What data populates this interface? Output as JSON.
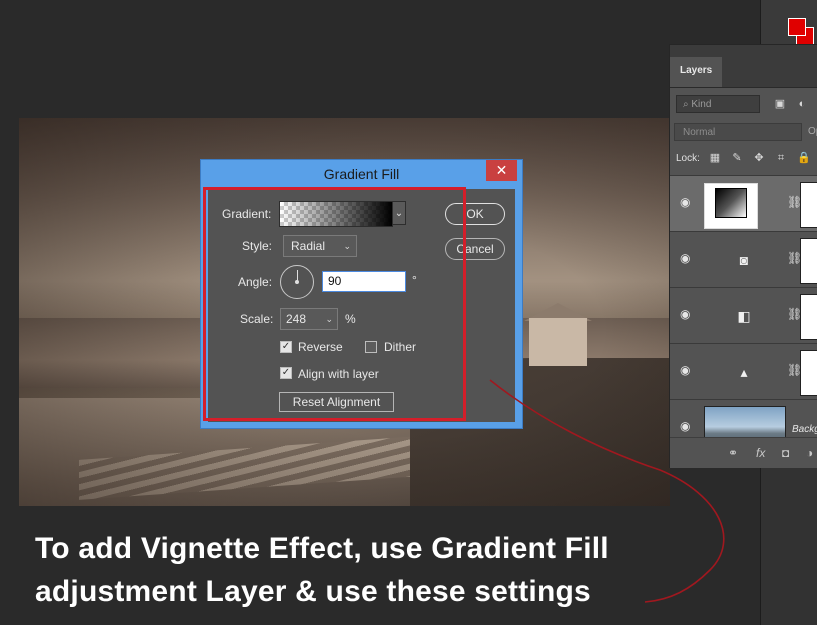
{
  "layers_panel": {
    "tab": "Layers",
    "kind_placeholder": "Kind",
    "blend_mode": "Normal",
    "opacity_label": "Op",
    "lock_label": "Lock:",
    "background_layer_name": "Backg",
    "footer_icons": [
      "link-icon",
      "fx-icon",
      "mask-icon",
      "adjustment-icon"
    ]
  },
  "dialog": {
    "title": "Gradient Fill",
    "close": "✕",
    "gradient_label": "Gradient:",
    "style_label": "Style:",
    "style_value": "Radial",
    "angle_label": "Angle:",
    "angle_value": "90",
    "angle_unit": "°",
    "scale_label": "Scale:",
    "scale_value": "248",
    "scale_unit": "%",
    "reverse_label": "Reverse",
    "reverse_checked": true,
    "dither_label": "Dither",
    "dither_checked": false,
    "align_label": "Align with layer",
    "align_checked": true,
    "reset_label": "Reset Alignment",
    "ok_label": "OK",
    "cancel_label": "Cancel"
  },
  "caption": {
    "line1": "To add Vignette Effect, use Gradient Fill",
    "line2": "adjustment Layer & use these settings"
  },
  "colors": {
    "foreground_swatch": "#e00000",
    "background_swatch": "#e00000",
    "highlight": "#d41e2a",
    "dialog_title_bar": "#59a0e8"
  }
}
